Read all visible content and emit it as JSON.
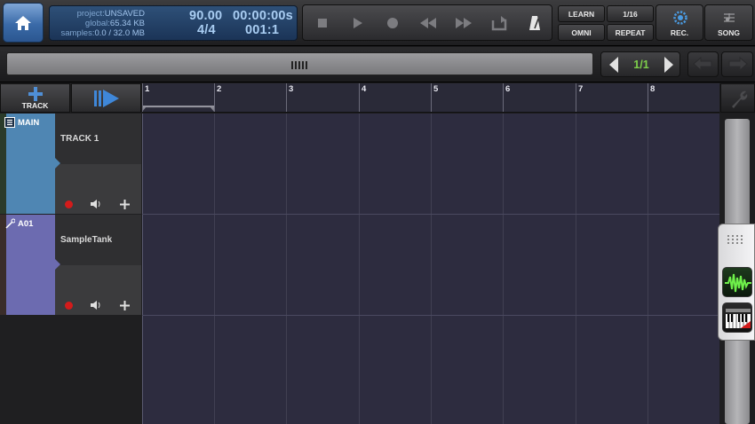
{
  "info": {
    "project_key": "project:",
    "project_value": "UNSAVED",
    "global_key": "global:",
    "global_value": "65.34 KB",
    "samples_key": "samples:",
    "samples_value": "0.0 / 32.0 MB",
    "tempo": "90.00",
    "time": "00:00:00s",
    "signature": "4/4",
    "position": "001:1"
  },
  "buttons": {
    "learn": "LEARN",
    "quantize": "1/16",
    "omni": "OMNI",
    "repeat": "REPEAT",
    "rec": "REC.",
    "song": "SONG",
    "track": "TRACK"
  },
  "page_nav": {
    "label": "1/1"
  },
  "ruler": {
    "bars": [
      "1",
      "2",
      "3",
      "4",
      "5",
      "6",
      "7",
      "8"
    ]
  },
  "tracks": [
    {
      "tag": "MAIN",
      "name": "TRACK 1",
      "color": "#4f86b3"
    },
    {
      "tag": "A01",
      "name": "SampleTank",
      "color": "#6c6bb0"
    }
  ],
  "colors": {
    "accent_blue": "#3a6aa8",
    "page_label_green": "#7ed04a",
    "record_red": "#d31b1b"
  },
  "icons": {
    "home": "home-icon",
    "stop": "stop-icon",
    "play": "play-icon",
    "record": "record-icon",
    "rewind": "rewind-icon",
    "fast_forward": "fast-forward-icon",
    "loop": "loop-icon",
    "metronome": "metronome-icon",
    "rec_gear": "gear-icon",
    "song": "song-icon",
    "undo": "undo-icon",
    "redo": "redo-icon",
    "wrench": "wrench-icon"
  }
}
